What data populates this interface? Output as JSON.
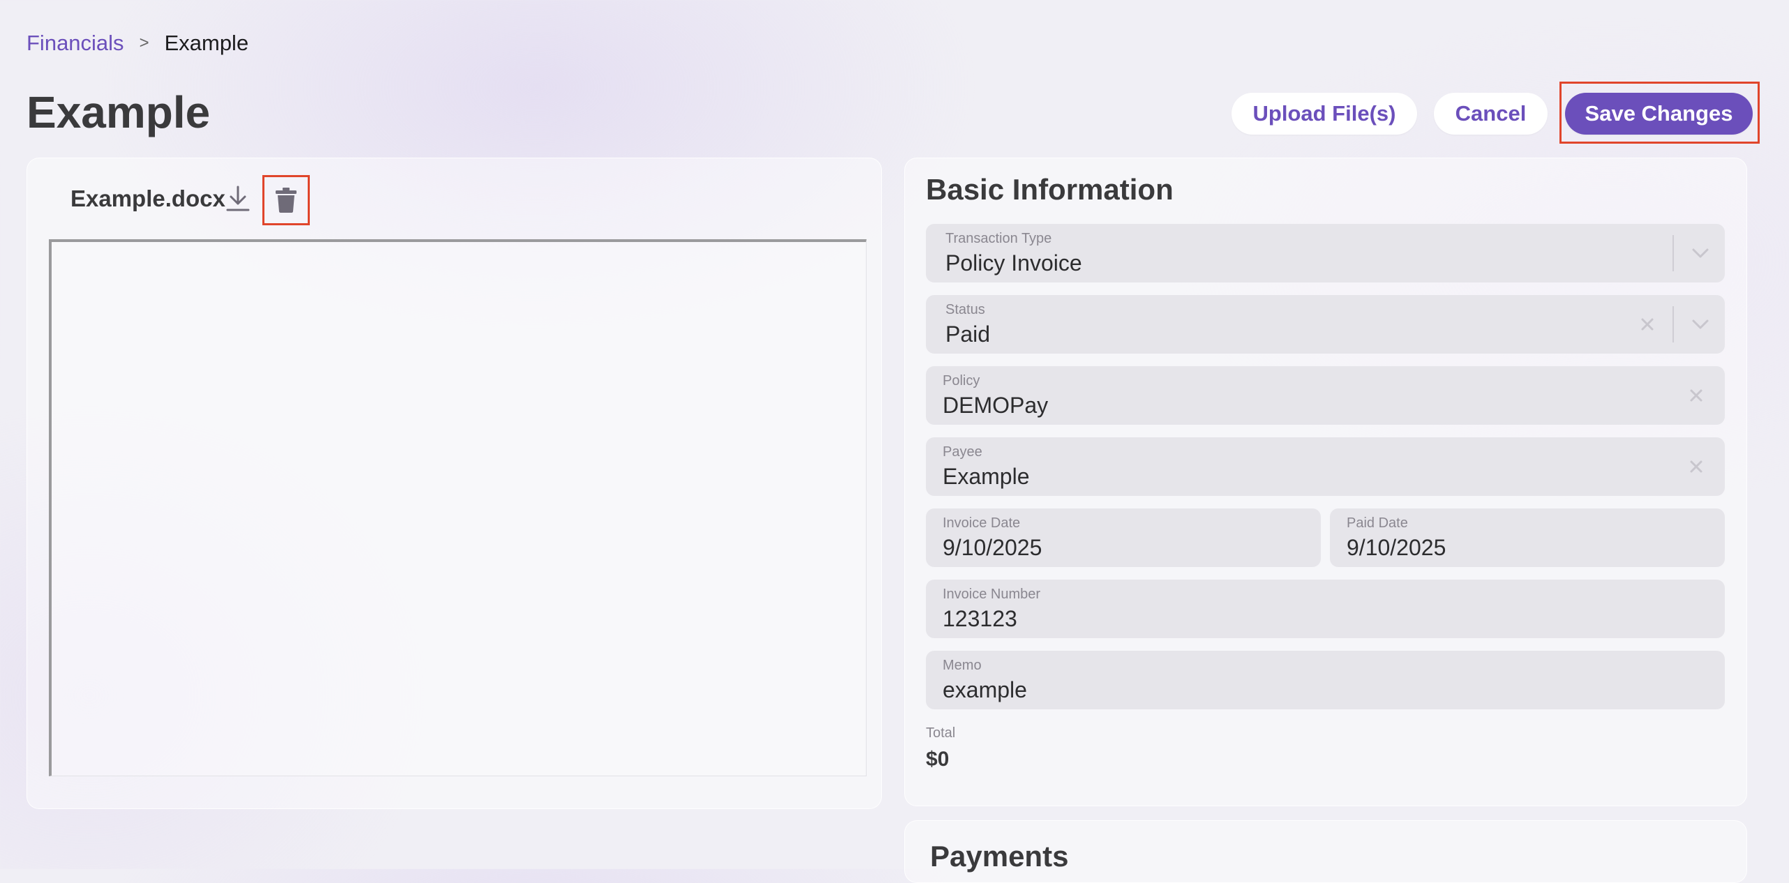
{
  "breadcrumb": {
    "parent": "Financials",
    "separator": ">",
    "current": "Example"
  },
  "page": {
    "title": "Example"
  },
  "actions": {
    "upload": "Upload File(s)",
    "cancel": "Cancel",
    "save": "Save Changes"
  },
  "file": {
    "name": "Example.docx"
  },
  "basic_info": {
    "title": "Basic Information",
    "transaction_type": {
      "label": "Transaction Type",
      "value": "Policy Invoice"
    },
    "status": {
      "label": "Status",
      "value": "Paid"
    },
    "policy": {
      "label": "Policy",
      "value": "DEMOPay"
    },
    "payee": {
      "label": "Payee",
      "value": "Example"
    },
    "invoice_date": {
      "label": "Invoice Date",
      "value": "9/10/2025"
    },
    "paid_date": {
      "label": "Paid Date",
      "value": "9/10/2025"
    },
    "invoice_number": {
      "label": "Invoice Number",
      "value": "123123"
    },
    "memo": {
      "label": "Memo",
      "value": "example"
    },
    "total": {
      "label": "Total",
      "value": "$0"
    }
  },
  "payments": {
    "title": "Payments"
  },
  "colors": {
    "accent": "#6b4fbb",
    "highlight": "#e0452b",
    "field_bg": "#e6e5ea"
  },
  "icons": [
    "download-icon",
    "trash-icon",
    "chevron-down-icon",
    "clear-icon"
  ]
}
